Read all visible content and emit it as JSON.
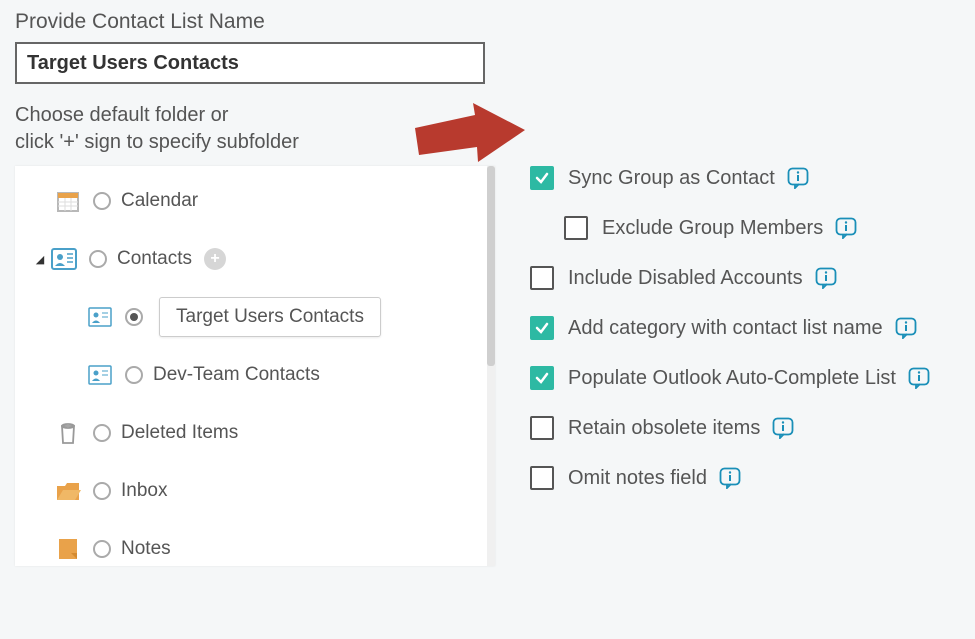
{
  "name_section": {
    "label": "Provide Contact List Name",
    "value": "Target Users Contacts"
  },
  "folder_section": {
    "label_line1": "Choose default folder or",
    "label_line2": "click '+' sign to specify subfolder",
    "tree": {
      "calendar": {
        "label": "Calendar",
        "selected": false
      },
      "contacts": {
        "label": "Contacts",
        "selected": false,
        "expanded": true,
        "children": [
          {
            "label": "Target Users Contacts",
            "selected": true
          },
          {
            "label": "Dev-Team Contacts",
            "selected": false
          }
        ]
      },
      "deleted": {
        "label": "Deleted Items",
        "selected": false
      },
      "inbox": {
        "label": "Inbox",
        "selected": false
      },
      "notes": {
        "label": "Notes",
        "selected": false
      }
    }
  },
  "options": [
    {
      "key": "sync_group",
      "label": "Sync Group as Contact",
      "checked": true,
      "indent": false
    },
    {
      "key": "exclude_members",
      "label": "Exclude Group Members",
      "checked": false,
      "indent": true
    },
    {
      "key": "include_disabled",
      "label": "Include Disabled Accounts",
      "checked": false,
      "indent": false
    },
    {
      "key": "add_category",
      "label": "Add category with contact list name",
      "checked": true,
      "indent": false
    },
    {
      "key": "populate_autocomplete",
      "label": "Populate Outlook Auto-Complete List",
      "checked": true,
      "indent": false
    },
    {
      "key": "retain_obsolete",
      "label": "Retain obsolete items",
      "checked": false,
      "indent": false
    },
    {
      "key": "omit_notes",
      "label": "Omit notes field",
      "checked": false,
      "indent": false
    }
  ],
  "icons": {
    "info_color": "#1a8fb8",
    "accent": "#2db9a3",
    "arrow_color": "#b83a2e"
  }
}
